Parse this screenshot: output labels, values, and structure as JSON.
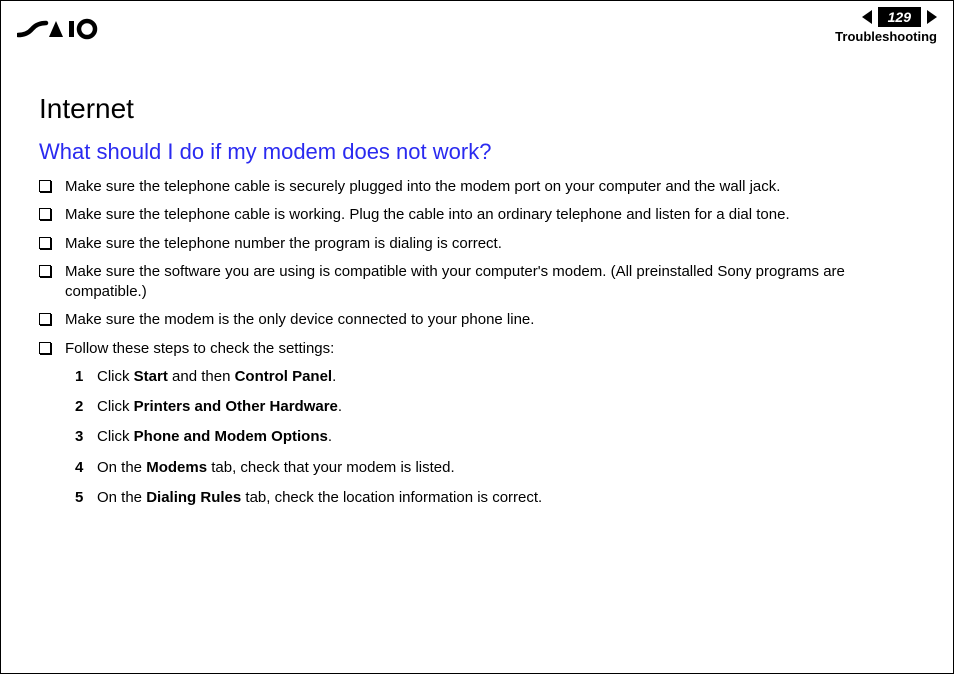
{
  "header": {
    "page_number": "129",
    "section": "Troubleshooting"
  },
  "content": {
    "title": "Internet",
    "question": "What should I do if my modem does not work?",
    "bullets": [
      "Make sure the telephone cable is securely plugged into the modem port on your computer and the wall jack.",
      "Make sure the telephone cable is working. Plug the cable into an ordinary telephone and listen for a dial tone.",
      "Make sure the telephone number the program is dialing is correct.",
      "Make sure the software you are using is compatible with your computer's modem. (All preinstalled Sony programs are compatible.)",
      "Make sure the modem is the only device connected to your phone line.",
      "Follow these steps to check the settings:"
    ],
    "steps": [
      {
        "n": "1",
        "pre": "Click ",
        "b1": "Start",
        "mid": " and then ",
        "b2": "Control Panel",
        "post": "."
      },
      {
        "n": "2",
        "pre": "Click ",
        "b1": "Printers and Other Hardware",
        "mid": "",
        "b2": "",
        "post": "."
      },
      {
        "n": "3",
        "pre": "Click ",
        "b1": "Phone and Modem Options",
        "mid": "",
        "b2": "",
        "post": "."
      },
      {
        "n": "4",
        "pre": "On the ",
        "b1": "Modems",
        "mid": " tab, check that your modem is listed.",
        "b2": "",
        "post": ""
      },
      {
        "n": "5",
        "pre": "On the ",
        "b1": "Dialing Rules",
        "mid": " tab, check the location information is correct.",
        "b2": "",
        "post": ""
      }
    ]
  }
}
